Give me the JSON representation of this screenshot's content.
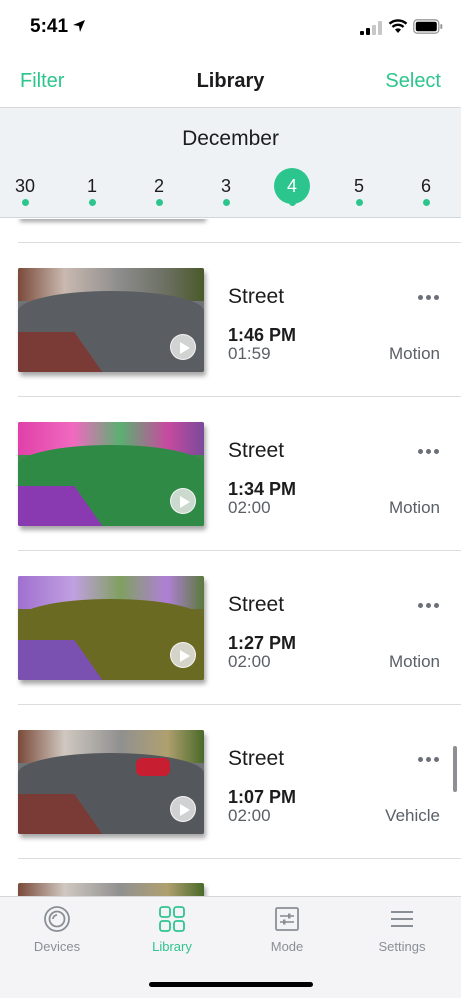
{
  "status_bar": {
    "time": "5:41"
  },
  "nav": {
    "left_action": "Filter",
    "title": "Library",
    "right_action": "Select"
  },
  "calendar": {
    "month": "December",
    "days": [
      {
        "label": "30",
        "selected": false
      },
      {
        "label": "1",
        "selected": false
      },
      {
        "label": "2",
        "selected": false
      },
      {
        "label": "3",
        "selected": false
      },
      {
        "label": "4",
        "selected": true
      },
      {
        "label": "5",
        "selected": false
      },
      {
        "label": "6",
        "selected": false
      }
    ]
  },
  "clips": [
    {
      "camera": "Street",
      "time": "1:46 PM",
      "duration": "01:59",
      "trigger": "Motion",
      "thumbnail_tint": "natural"
    },
    {
      "camera": "Street",
      "time": "1:34 PM",
      "duration": "02:00",
      "trigger": "Motion",
      "thumbnail_tint": "magenta-green"
    },
    {
      "camera": "Street",
      "time": "1:27 PM",
      "duration": "02:00",
      "trigger": "Motion",
      "thumbnail_tint": "purple-olive"
    },
    {
      "camera": "Street",
      "time": "1:07 PM",
      "duration": "02:00",
      "trigger": "Vehicle",
      "thumbnail_tint": "natural-red-car"
    }
  ],
  "tabs": [
    {
      "label": "Devices",
      "icon": "devices-icon",
      "active": false
    },
    {
      "label": "Library",
      "icon": "library-grid-icon",
      "active": true
    },
    {
      "label": "Mode",
      "icon": "mode-sliders-icon",
      "active": false
    },
    {
      "label": "Settings",
      "icon": "settings-menu-icon",
      "active": false
    }
  ],
  "colors": {
    "accent": "#2dc58e",
    "secondary_text": "#5a5f66",
    "date_strip_bg": "#eef2f5",
    "tab_bar_bg": "#f4f4f6"
  }
}
